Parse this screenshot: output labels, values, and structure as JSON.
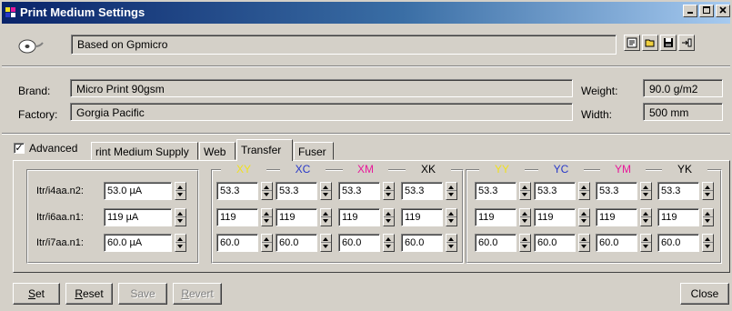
{
  "window": {
    "title": "Print Medium Settings"
  },
  "profile": {
    "name": "Based on Gpmicro"
  },
  "brand": {
    "label": "Brand:",
    "value": "Micro Print 90gsm"
  },
  "factory": {
    "label": "Factory:",
    "value": "Gorgia Pacific"
  },
  "weight": {
    "label": "Weight:",
    "value": "90.0 g/m2"
  },
  "width": {
    "label": "Width:",
    "value": "500 mm"
  },
  "advanced": {
    "label": "Advanced",
    "checked": true,
    "mark": "✓"
  },
  "tabs": [
    {
      "label": "rint Medium Supply",
      "active": false
    },
    {
      "label": "Web",
      "active": false
    },
    {
      "label": "Transfer",
      "active": true
    },
    {
      "label": "Fuser",
      "active": false
    }
  ],
  "transfer": {
    "row_labels": [
      "Itr/i4aa.n2:",
      "Itr/i6aa.n1:",
      "Itr/i7aa.n1:"
    ],
    "base_values": [
      "53.0 µA",
      "119 µA",
      "60.0 µA"
    ],
    "group1_headers": [
      {
        "label": "XY",
        "color": "#f0e020"
      },
      {
        "label": "XC",
        "color": "#2838c8"
      },
      {
        "label": "XM",
        "color": "#e8189a"
      },
      {
        "label": "XK",
        "color": "#000000"
      }
    ],
    "group2_headers": [
      {
        "label": "YY",
        "color": "#f0e020"
      },
      {
        "label": "YC",
        "color": "#2838c8"
      },
      {
        "label": "YM",
        "color": "#e8189a"
      },
      {
        "label": "YK",
        "color": "#000000"
      }
    ],
    "rows": [
      [
        "53.3",
        "53.3",
        "53.3",
        "53.3",
        "53.3",
        "53.3",
        "53.3",
        "53.3"
      ],
      [
        "119",
        "119",
        "119",
        "119",
        "119",
        "119",
        "119",
        "119"
      ],
      [
        "60.0",
        "60.0",
        "60.0",
        "60.0",
        "60.0",
        "60.0",
        "60.0",
        "60.0"
      ]
    ]
  },
  "buttons": {
    "set": {
      "underline": "S",
      "rest": "et"
    },
    "reset": {
      "underline": "R",
      "rest": "eset"
    },
    "save": {
      "label": "Save"
    },
    "revert": {
      "underline": "R",
      "rest": "evert"
    },
    "close": {
      "label": "Close"
    }
  },
  "colors": {
    "title_start": "#0a246a",
    "title_end": "#a6caf0",
    "face": "#d4d0c8"
  }
}
